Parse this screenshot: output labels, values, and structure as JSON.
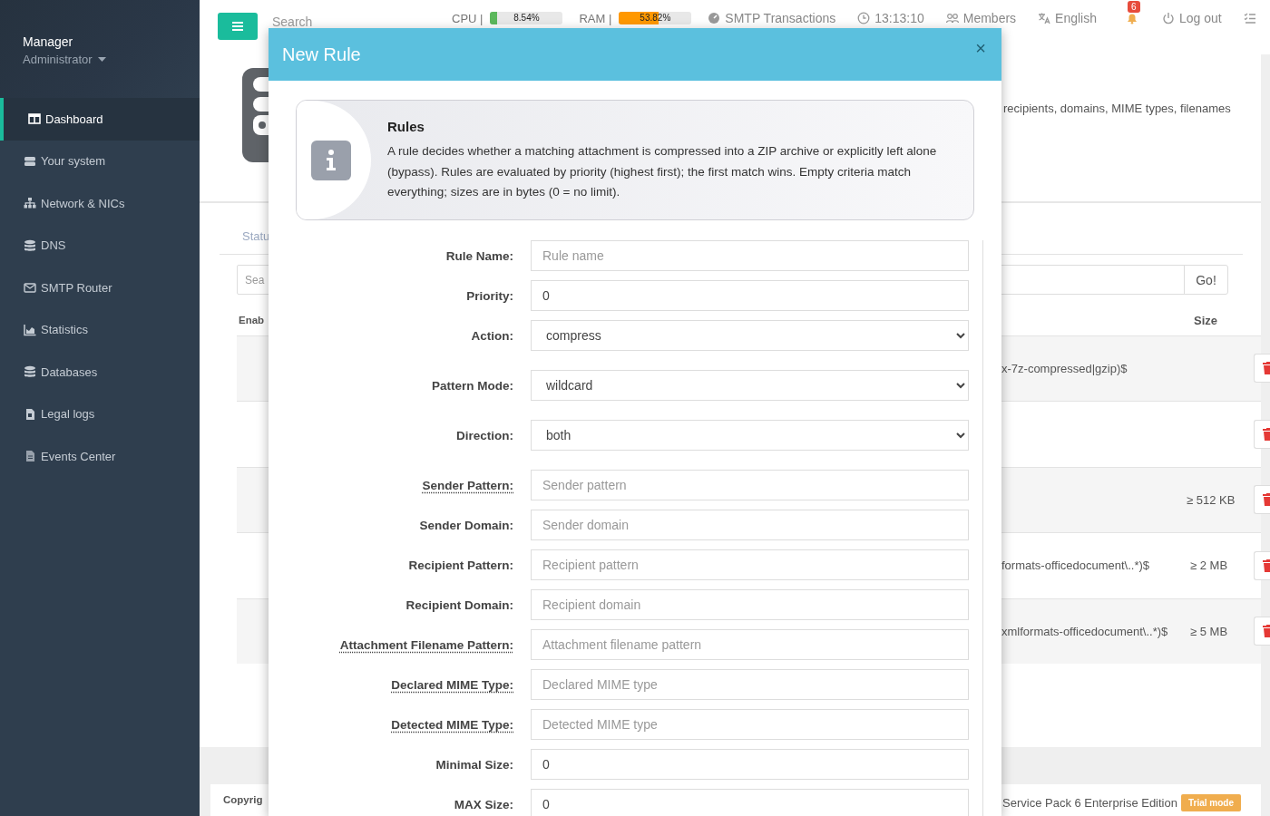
{
  "sidebar": {
    "user": {
      "name": "Manager",
      "role": "Administrator"
    },
    "items": [
      {
        "label": "Dashboard",
        "selected": true
      },
      {
        "label": "Your system",
        "selected": false
      },
      {
        "label": "Network & NICs",
        "selected": false
      },
      {
        "label": "DNS",
        "selected": false
      },
      {
        "label": "SMTP Router",
        "selected": false
      },
      {
        "label": "Statistics",
        "selected": false
      },
      {
        "label": "Databases",
        "selected": false
      },
      {
        "label": "Legal logs",
        "selected": false
      },
      {
        "label": "Events Center",
        "selected": false
      }
    ]
  },
  "topbar": {
    "search": {
      "placeholder": "Search"
    },
    "meters": [
      {
        "label": "CPU |",
        "reading": "8.54%",
        "level": 0.09,
        "color": "#5cb85c"
      },
      {
        "label": "RAM |",
        "reading": "53.82%",
        "level": 0.54,
        "color": "#ff9800"
      }
    ],
    "links": [
      {
        "kind": "transactions",
        "label": "SMTP Transactions"
      },
      {
        "kind": "clock",
        "label": "13:13:10"
      },
      {
        "kind": "members",
        "label": "Members"
      },
      {
        "kind": "language",
        "label": "English"
      },
      {
        "kind": "notifications",
        "badge": "6"
      },
      {
        "kind": "logout",
        "label": "Log out"
      },
      {
        "kind": "tasks"
      }
    ]
  },
  "page": {
    "description": "recipients, domains, MIME types, filenames",
    "tab": "Statu",
    "search": {
      "placeholder": "Sea"
    },
    "go_button": "Go!",
    "columns": [
      "Enab",
      "Size"
    ],
    "rows": [
      {
        "column_2": "x-7z-compressed|gzip)$"
      },
      {},
      {
        "size": "≥ 512 KB"
      },
      {
        "column_2": "formats-officedocument\\..*)$",
        "size": "≥ 2 MB"
      },
      {
        "column_2": "xmlformats-officedocument\\..*)$",
        "size": "≥ 5 MB"
      }
    ]
  },
  "footer": {
    "copyright": "Copyrig",
    "edition": "Service Pack 6 Enterprise Edition",
    "badge": "Trial mode"
  },
  "modal": {
    "title": "New Rule",
    "close": "×",
    "callout": {
      "title": "Rules",
      "text": "A rule decides whether a matching attachment is compressed into a ZIP archive or explicitly left alone (bypass). Rules are evaluated by priority (highest first); the first match wins. Empty criteria match everything; sizes are in bytes (0 = no limit)."
    },
    "fields": [
      {
        "kind": "text",
        "label": "Rule Name:",
        "placeholder": "Rule name",
        "hint": false
      },
      {
        "kind": "text",
        "label": "Priority:",
        "value": "0",
        "hint": false
      },
      {
        "kind": "select",
        "label": "Action:",
        "value": "compress",
        "hint": false
      },
      {
        "kind": "select",
        "label": "Pattern Mode:",
        "value": "wildcard",
        "hint": false
      },
      {
        "kind": "select",
        "label": "Direction:",
        "value": "both",
        "hint": false
      },
      {
        "kind": "text",
        "label": "Sender Pattern:",
        "placeholder": "Sender pattern",
        "hint": true
      },
      {
        "kind": "text",
        "label": "Sender Domain:",
        "placeholder": "Sender domain",
        "hint": false
      },
      {
        "kind": "text",
        "label": "Recipient Pattern:",
        "placeholder": "Recipient pattern",
        "hint": false
      },
      {
        "kind": "text",
        "label": "Recipient Domain:",
        "placeholder": "Recipient domain",
        "hint": false
      },
      {
        "kind": "text",
        "label": "Attachment Filename Pattern:",
        "placeholder": "Attachment filename pattern",
        "hint": true
      },
      {
        "kind": "text",
        "label": "Declared MIME Type:",
        "placeholder": "Declared MIME type",
        "hint": true
      },
      {
        "kind": "text",
        "label": "Detected MIME Type:",
        "placeholder": "Detected MIME type",
        "hint": true
      },
      {
        "kind": "text",
        "label": "Minimal Size:",
        "value": "0",
        "hint": false
      },
      {
        "kind": "text",
        "label": "MAX Size:",
        "value": "0",
        "hint": false
      }
    ]
  }
}
